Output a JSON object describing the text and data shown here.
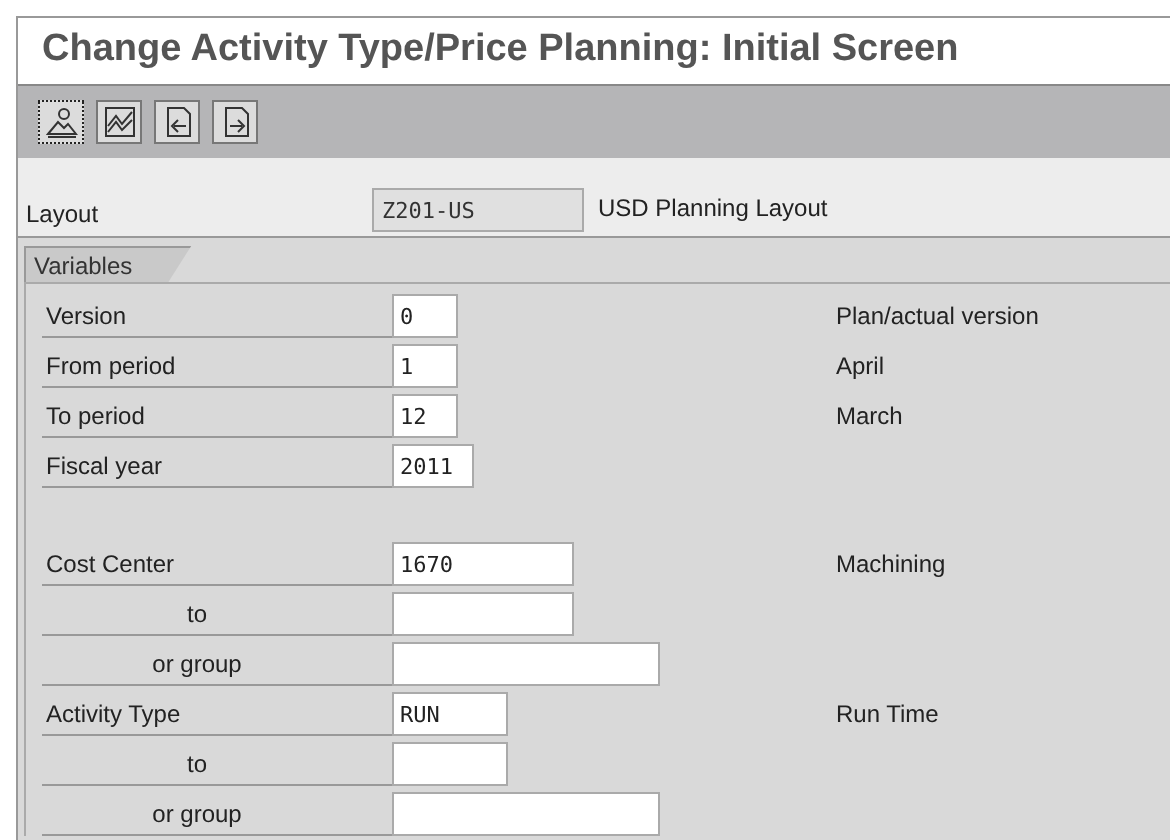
{
  "window": {
    "title": "Change Activity Type/Price Planning: Initial Screen"
  },
  "toolbar": {
    "buttons": [
      {
        "kind": "picture",
        "focused": true
      },
      {
        "kind": "chart",
        "focused": false
      },
      {
        "kind": "back",
        "focused": false
      },
      {
        "kind": "forward",
        "focused": false
      }
    ]
  },
  "layout": {
    "label": "Layout",
    "value": "Z201-US",
    "disabled": true,
    "description": "USD Planning Layout"
  },
  "tab": {
    "label": "Variables"
  },
  "groups": [
    {
      "rows": [
        {
          "label": "Version",
          "value": "0",
          "kind": "tiny",
          "indented": false,
          "description": "Plan/actual version"
        },
        {
          "label": "From period",
          "value": "1",
          "kind": "tiny",
          "indented": false,
          "description": "April"
        },
        {
          "label": "To period",
          "value": "12",
          "kind": "tiny",
          "indented": false,
          "description": "March"
        },
        {
          "label": "Fiscal year",
          "value": "2011",
          "kind": "year",
          "indented": false
        }
      ]
    },
    {
      "rows": [
        {
          "label": "Cost Center",
          "value": "1670",
          "kind": "wide",
          "indented": false,
          "description": "Machining"
        },
        {
          "label": "to",
          "kind": "wide",
          "indented": true
        },
        {
          "label": "or group",
          "kind": "group",
          "indented": true
        },
        {
          "label": "Activity Type",
          "value": "RUN",
          "kind": "code",
          "indented": false,
          "description": "Run Time"
        },
        {
          "label": "to",
          "kind": "code",
          "indented": true
        },
        {
          "label": "or group",
          "kind": "group",
          "indented": true
        }
      ]
    }
  ]
}
